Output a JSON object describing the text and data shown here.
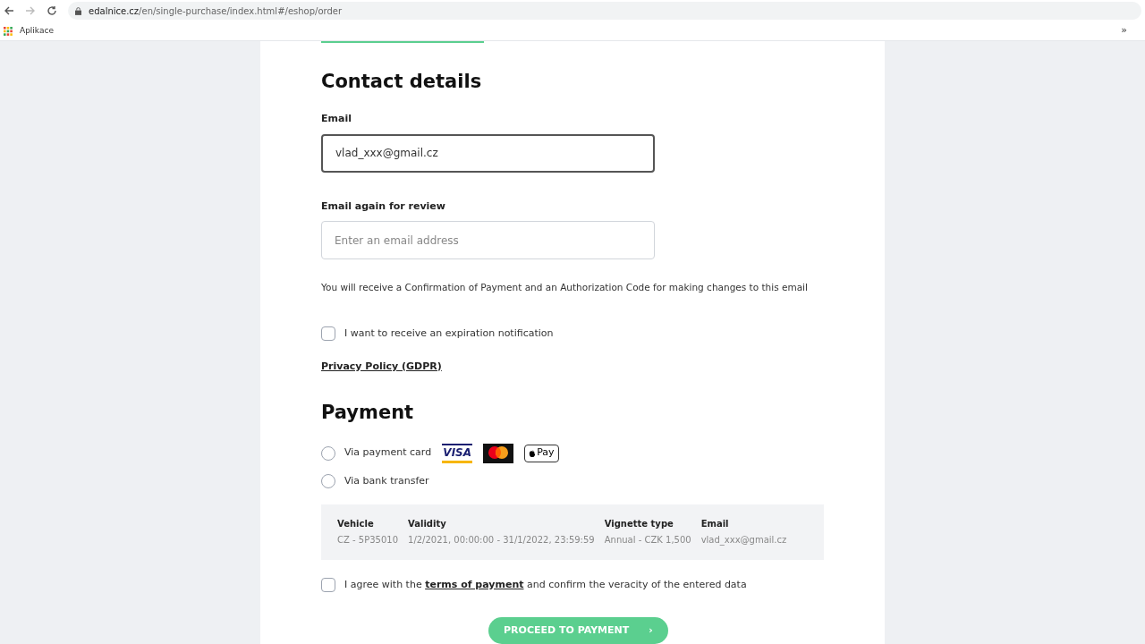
{
  "browser": {
    "url_host": "edalnice.cz",
    "url_path": "/en/single-purchase/index.html#/eshop/order",
    "bookmark": "Aplikace",
    "overflow": "»"
  },
  "contact": {
    "title": "Contact details",
    "email": {
      "label": "Email",
      "value": "vlad_xxx@gmail.cz",
      "focused": true
    },
    "email_again": {
      "label": "Email again for review",
      "placeholder": "Enter an email address",
      "focused": false
    },
    "note": "You will receive a Confirmation of Payment and an Authorization Code for making changes to this email",
    "notification": {
      "label": "I want to receive an expiration notification",
      "checked": false
    },
    "privacy_link": "Privacy Policy (GDPR)"
  },
  "payment": {
    "title": "Payment",
    "methods": [
      {
        "label": "Via payment card",
        "selected": false,
        "logos": [
          "VISA",
          "Pay"
        ]
      },
      {
        "label": "Via bank transfer",
        "selected": false
      }
    ],
    "summary": [
      {
        "heading": "Vehicle",
        "value": "CZ - 5P35010"
      },
      {
        "heading": "Validity",
        "value": "1/2/2021, 00:00:00 - 31/1/2022, 23:59:59"
      },
      {
        "heading": "Vignette type",
        "value": "Annual - CZK 1,500"
      },
      {
        "heading": "Email",
        "value": "vlad_xxx@gmail.cz"
      }
    ],
    "agree": {
      "before": "I agree with the",
      "link": "terms of payment",
      "after": "and confirm the veracity of the entered data",
      "checked": false
    },
    "button": {
      "label": "PROCEED TO PAYMENT",
      "arrow": "›"
    }
  }
}
